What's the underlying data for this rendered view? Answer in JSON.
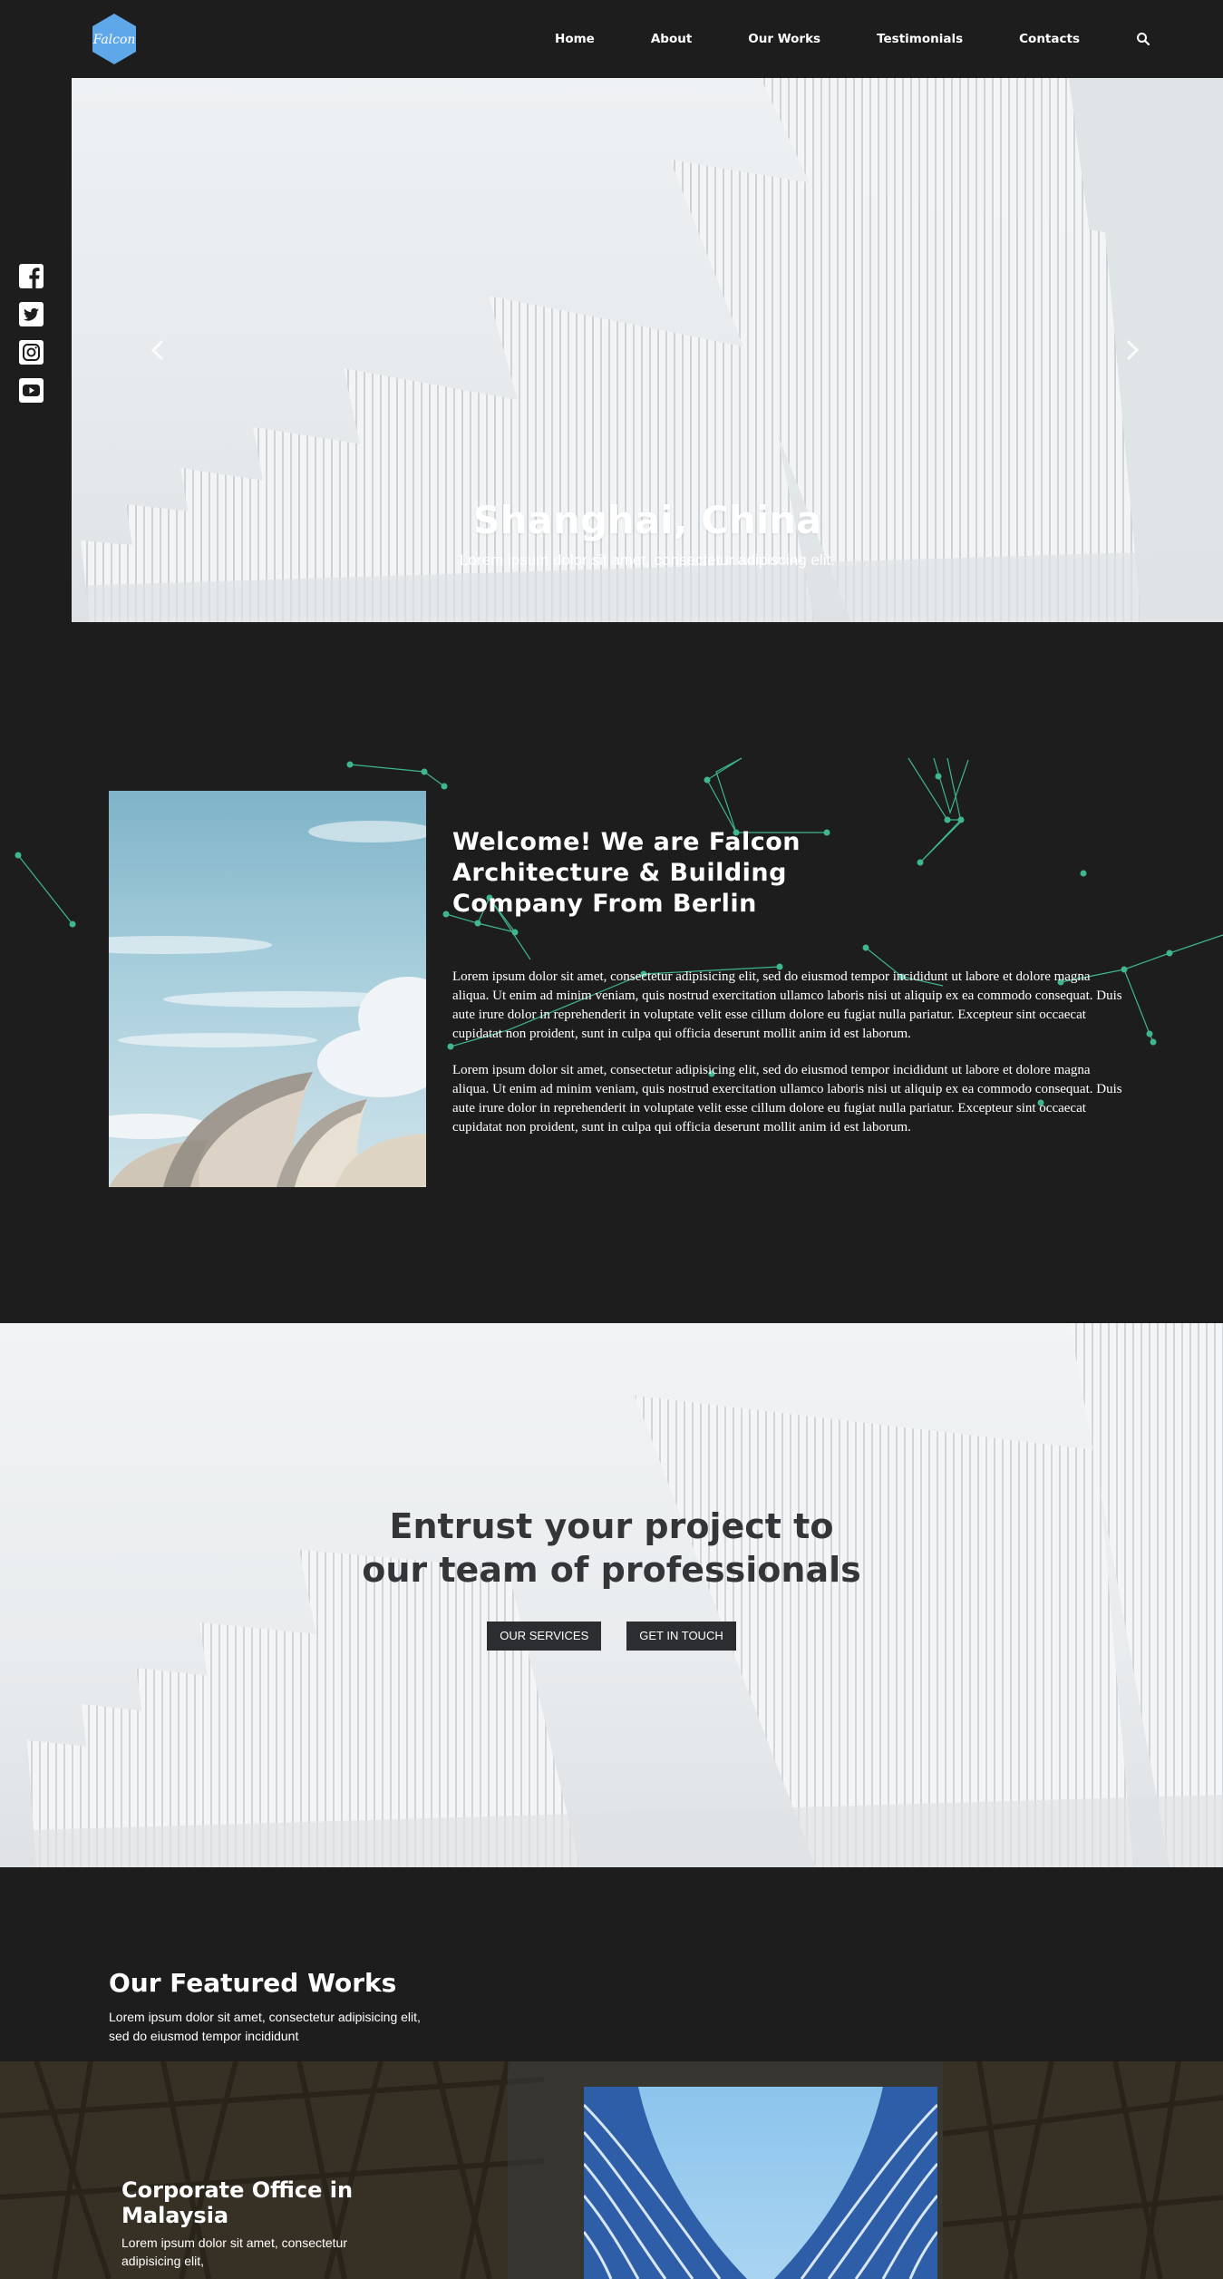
{
  "brand": {
    "logo_text": "Falcon",
    "accent": "#5ea7e8"
  },
  "nav": {
    "items": [
      {
        "label": "Home"
      },
      {
        "label": "About"
      },
      {
        "label": "Our Works"
      },
      {
        "label": "Testimonials"
      },
      {
        "label": "Contacts"
      }
    ],
    "search_icon": "search-icon"
  },
  "social": [
    "facebook-icon",
    "twitter-icon",
    "instagram-icon",
    "youtube-icon"
  ],
  "hero": {
    "title": "Shanghai, China",
    "subtitle": "Lorem ipsum dolor sit amet, consectetur adipiscing elit."
  },
  "welcome": {
    "title": "Welcome! We are Falcon Architecture & Building Company From Berlin",
    "paragraph_1": "Lorem ipsum dolor sit amet, consectetur adipisicing elit, sed do eiusmod tempor incididunt ut labore et dolore magna aliqua. Ut enim ad minim veniam, quis nostrud exercitation ullamco laboris nisi ut aliquip ex ea commodo consequat. Duis aute irure dolor in reprehenderit in voluptate velit esse cillum dolore eu fugiat nulla pariatur. Excepteur sint occaecat cupidatat non proident, sunt in culpa qui officia deserunt mollit anim id est laborum.",
    "paragraph_2": "Lorem ipsum dolor sit amet, consectetur adipisicing elit, sed do eiusmod tempor incididunt ut labore et dolore magna aliqua. Ut enim ad minim veniam, quis nostrud exercitation ullamco laboris nisi ut aliquip ex ea commodo consequat. Duis aute irure dolor in reprehenderit in voluptate velit esse cillum dolore eu fugiat nulla pariatur. Excepteur sint occaecat cupidatat non proident, sunt in culpa qui officia deserunt mollit anim id est laborum.",
    "network_color": "#3fb68e"
  },
  "cta": {
    "title": "Entrust your project to our team of professionals",
    "button_services": "OUR SERVICES",
    "button_contact": "GET IN TOUCH"
  },
  "featured": {
    "title": "Our Featured Works",
    "subtitle": "Lorem ipsum dolor sit amet, consectetur adipisicing elit, sed do eiusmod tempor incididunt",
    "project": {
      "title": "Corporate Office in Malaysia",
      "description": "Lorem ipsum dolor sit amet, consectetur adipisicing elit,"
    }
  }
}
